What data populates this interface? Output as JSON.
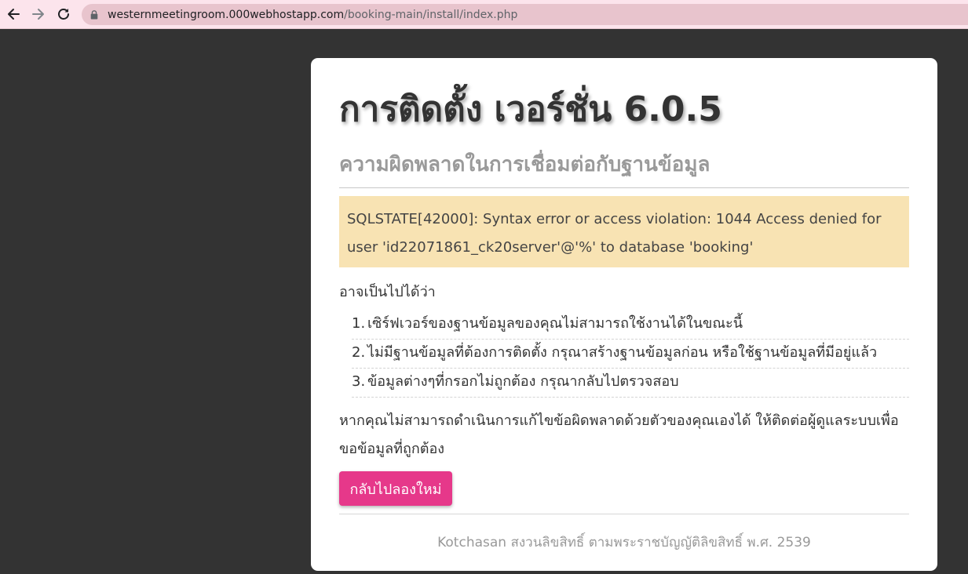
{
  "browser": {
    "back_icon": "arrow-left-icon",
    "forward_icon": "arrow-right-icon",
    "reload_icon": "reload-icon",
    "url_host": "westernmeetingroom.000webhostapp.com",
    "url_path": "/booking-main/install/index.php"
  },
  "page": {
    "title": "การติดตั้ง เวอร์ชั่น 6.0.5",
    "subtitle": "ความผิดพลาดในการเชื่อมต่อกับฐานข้อมูล",
    "error_message": "SQLSTATE[42000]: Syntax error or access violation: 1044 Access denied for user 'id22071861_ck20server'@'%' to database 'booking'",
    "lead": "อาจเป็นไปได้ว่า",
    "reasons": [
      {
        "num": "1.",
        "text": "เซิร์ฟเวอร์ของฐานข้อมูลของคุณไม่สามารถใช้งานได้ในขณะนี้"
      },
      {
        "num": "2.",
        "text": "ไม่มีฐานข้อมูลที่ต้องการติดตั้ง กรุณาสร้างฐานข้อมูลก่อน หรือใช้ฐานข้อมูลที่มีอยู่แล้ว"
      },
      {
        "num": "3.",
        "text": "ข้อมูลต่างๆที่กรอกไม่ถูกต้อง กรุณากลับไปตรวจสอบ"
      }
    ],
    "advice": "หากคุณไม่สามารถดำเนินการแก้ไขข้อผิดพลาดด้วยตัวของคุณเองได้ ให้ติดต่อผู้ดูแลระบบเพื่อขอข้อมูลที่ถูกต้อง",
    "retry_label": "กลับไปลองใหม่",
    "footer": "Kotchasan สงวนลิขสิทธิ์ ตามพระราชบัญญัติลิขสิทธิ์ พ.ศ. 2539"
  },
  "colors": {
    "background": "#333333",
    "browser_bar": "#fce4ec",
    "error_bg": "#f8e3b3",
    "button": "#e6388a"
  }
}
